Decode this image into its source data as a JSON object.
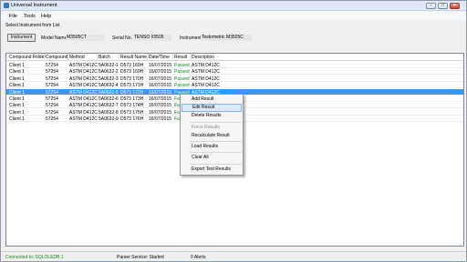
{
  "window": {
    "title": "Universal Instrument"
  },
  "menu": [
    "File",
    "Tools",
    "Help"
  ],
  "hint": "Select Instrument from List",
  "toolbar": {
    "instrument_button": "Instrument",
    "model_label": "Model Name",
    "model_value": "M3505CT",
    "serial_label": "Serial No.",
    "serial_value": "TENSO #3505",
    "instrument_label": "Instrument",
    "instrument_value": "Testometric M3505C"
  },
  "grid": {
    "columns": [
      "Compound Folder",
      "Compound",
      "Method",
      "Batch",
      "Result Name",
      "Date/Time",
      "Result",
      "Description"
    ],
    "rows": [
      [
        "Client 1",
        "57254",
        "ASTM D412C",
        "5A0632-1",
        "D573 169H",
        "16/07/2015",
        "Passed",
        "ASTM D412C"
      ],
      [
        "Client 1",
        "57254",
        "ASTM D412C",
        "5A0632-2",
        "D573 169H",
        "16/07/2015",
        "Passed",
        "ASTM D412C"
      ],
      [
        "Client 1",
        "57254",
        "ASTM D412C",
        "5A0632-3",
        "D573 170H",
        "16/07/2015",
        "Passed",
        "ASTM D412C"
      ],
      [
        "Client 1",
        "57254",
        "ASTM D412C",
        "5A0632-4",
        "D573 171H",
        "16/07/2015",
        "Passed",
        "ASTM D412C"
      ],
      [
        "Client 1",
        "57254",
        "ASTM D412C",
        "5A0632-5",
        "D573 172H",
        "16/07/2015",
        "Passed",
        "ASTM D412C"
      ],
      [
        "Client 1",
        "57254",
        "ASTM D412C",
        "5A0632-6",
        "D573 173H",
        "16/07/2015",
        "Fa",
        ""
      ],
      [
        "Client 1",
        "57254",
        "ASTM D412C",
        "5A0632-7",
        "D573 174H",
        "16/07/2015",
        "Fa",
        ""
      ],
      [
        "Client 1",
        "57254",
        "ASTM D412C",
        "5A0632-8",
        "D573 175H",
        "16/07/2015",
        "Fa",
        ""
      ],
      [
        "Client 1",
        "57254",
        "ASTM D412C",
        "5A0632-9",
        "D573 176H",
        "16/07/2015",
        "Fa",
        ""
      ]
    ],
    "selected_index": 4
  },
  "context_menu": {
    "items": [
      {
        "label": "Add Result",
        "state": "normal"
      },
      {
        "label": "Edit Result",
        "state": "hover"
      },
      {
        "label": "Delete Results",
        "state": "normal"
      },
      {
        "label": "Force Results",
        "state": "disabled"
      },
      {
        "label": "Recalculate Result",
        "state": "normal"
      },
      {
        "label": "Load Results",
        "state": "normal"
      },
      {
        "label": "Clear All",
        "state": "normal"
      },
      {
        "label": "Export Test Results",
        "state": "normal"
      }
    ]
  },
  "status": {
    "connection": "Connected to: SQLOLEDB.1",
    "parser": "Parser Service: Started",
    "alerts": "0 Alerts"
  },
  "colors": {
    "selection": "#3399ff",
    "passed": "#0b8a1f",
    "connected": "#128a12"
  }
}
